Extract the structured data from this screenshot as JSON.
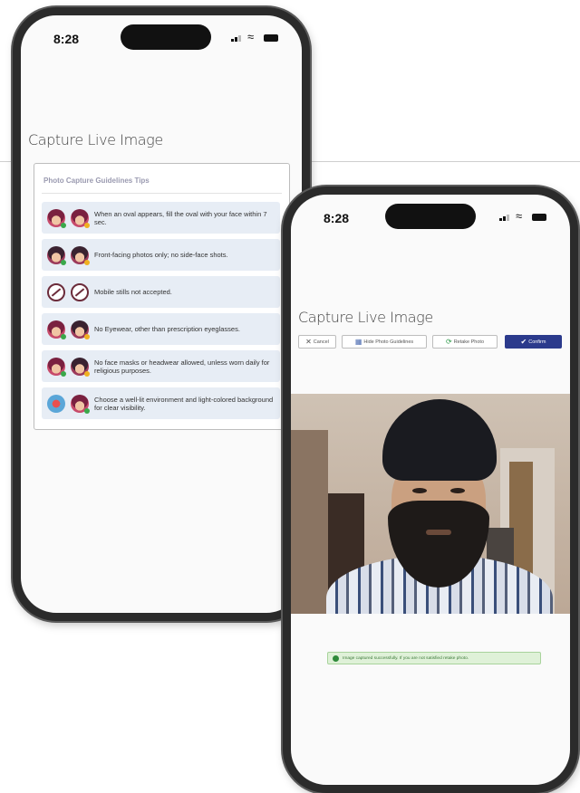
{
  "status_bar": {
    "time": "8:28"
  },
  "phone_left": {
    "page_title": "Capture Live Image",
    "guidelines": {
      "title": "Photo Capture Guidelines Tips",
      "tips": [
        {
          "text": "When an oval appears, fill the oval with your face within 7 sec.",
          "icons": [
            "face-in-oval-icon",
            "face-in-oval-icon"
          ]
        },
        {
          "text": "Front-facing photos only; no side-face shots.",
          "icons": [
            "front-face-icon",
            "side-face-icon"
          ]
        },
        {
          "text": "Mobile stills not accepted.",
          "icons": [
            "no-mobile-icon",
            "no-photo-icon"
          ]
        },
        {
          "text": "No Eyewear, other than prescription eyeglasses.",
          "icons": [
            "face-icon",
            "eyewear-icon"
          ]
        },
        {
          "text": "No face masks or headwear allowed, unless worn daily for religious purposes.",
          "icons": [
            "face-icon",
            "headwear-icon"
          ]
        },
        {
          "text": "Choose a well-lit environment and light-colored background for clear visibility.",
          "icons": [
            "environment-icon",
            "face-icon"
          ]
        }
      ]
    }
  },
  "phone_right": {
    "page_title": "Capture Live Image",
    "toolbar": {
      "cancel_label": "Cancel",
      "hide_label": "Hide Photo Guidelines",
      "retake_label": "Retake Photo",
      "confirm_label": "Confirm",
      "accent_color": "#2b3a8c"
    },
    "status_message": "Image captured successfully. If you are not satisfied retake photo.",
    "status_color": "#2f8a3a"
  }
}
